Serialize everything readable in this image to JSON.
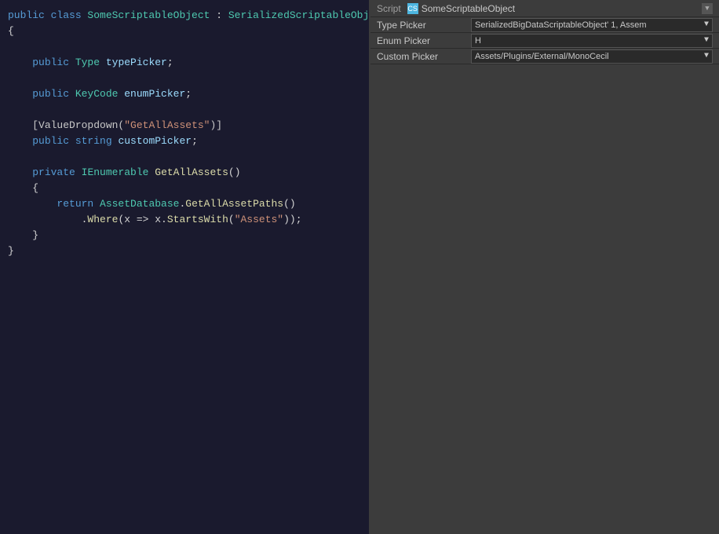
{
  "editor": {
    "background": "#1a1a2e",
    "lines": [
      {
        "id": 1,
        "tokens": [
          {
            "text": "public ",
            "class": "kw"
          },
          {
            "text": "class ",
            "class": "kw"
          },
          {
            "text": "SomeScriptableObject",
            "class": "class-name"
          },
          {
            "text": " : ",
            "class": "plain"
          },
          {
            "text": "SerializedScriptableObject",
            "class": "base-class"
          }
        ]
      },
      {
        "id": 2,
        "tokens": [
          {
            "text": "{",
            "class": "plain"
          }
        ]
      },
      {
        "id": 3,
        "tokens": [
          {
            "text": "    ",
            "class": "plain"
          }
        ]
      },
      {
        "id": 4,
        "tokens": [
          {
            "text": "    ",
            "class": "plain"
          },
          {
            "text": "public ",
            "class": "kw"
          },
          {
            "text": "Type ",
            "class": "kw-type"
          },
          {
            "text": "typePicker",
            "class": "field-name"
          },
          {
            "text": ";",
            "class": "plain"
          }
        ]
      },
      {
        "id": 5,
        "tokens": [
          {
            "text": "    ",
            "class": "plain"
          }
        ]
      },
      {
        "id": 6,
        "tokens": [
          {
            "text": "    ",
            "class": "plain"
          },
          {
            "text": "public ",
            "class": "kw"
          },
          {
            "text": "KeyCode ",
            "class": "kw-type"
          },
          {
            "text": "enumPicker",
            "class": "field-name"
          },
          {
            "text": ";",
            "class": "plain"
          }
        ]
      },
      {
        "id": 7,
        "tokens": [
          {
            "text": "    ",
            "class": "plain"
          }
        ]
      },
      {
        "id": 8,
        "tokens": [
          {
            "text": "    ",
            "class": "plain"
          },
          {
            "text": "[ValueDropdown(",
            "class": "attr"
          },
          {
            "text": "\"GetAllAssets\"",
            "class": "string"
          },
          {
            "text": ")]",
            "class": "attr"
          }
        ]
      },
      {
        "id": 9,
        "tokens": [
          {
            "text": "    ",
            "class": "plain"
          },
          {
            "text": "public ",
            "class": "kw"
          },
          {
            "text": "string ",
            "class": "kw"
          },
          {
            "text": "customPicker",
            "class": "field-name"
          },
          {
            "text": ";",
            "class": "plain"
          }
        ]
      },
      {
        "id": 10,
        "tokens": [
          {
            "text": "    ",
            "class": "plain"
          }
        ]
      },
      {
        "id": 11,
        "tokens": [
          {
            "text": "    ",
            "class": "plain"
          },
          {
            "text": "private ",
            "class": "kw"
          },
          {
            "text": "IEnumerable ",
            "class": "kw-type"
          },
          {
            "text": "GetAllAssets",
            "class": "method"
          },
          {
            "text": "()",
            "class": "plain"
          }
        ]
      },
      {
        "id": 12,
        "tokens": [
          {
            "text": "    ",
            "class": "plain"
          },
          {
            "text": "{",
            "class": "plain"
          }
        ]
      },
      {
        "id": 13,
        "tokens": [
          {
            "text": "        ",
            "class": "plain"
          },
          {
            "text": "return ",
            "class": "kw"
          },
          {
            "text": "AssetDatabase",
            "class": "kw-type"
          },
          {
            "text": ".",
            "class": "plain"
          },
          {
            "text": "GetAllAssetPaths",
            "class": "method"
          },
          {
            "text": "()",
            "class": "plain"
          }
        ]
      },
      {
        "id": 14,
        "tokens": [
          {
            "text": "            ",
            "class": "plain"
          },
          {
            "text": ".",
            "class": "plain"
          },
          {
            "text": "Where",
            "class": "method"
          },
          {
            "text": "(x => x.",
            "class": "plain"
          },
          {
            "text": "StartsWith",
            "class": "method"
          },
          {
            "text": "(",
            "class": "plain"
          },
          {
            "text": "\"Assets\"",
            "class": "string"
          },
          {
            "text": "));",
            "class": "plain"
          }
        ]
      },
      {
        "id": 15,
        "tokens": [
          {
            "text": "    ",
            "class": "plain"
          },
          {
            "text": "}",
            "class": "plain"
          }
        ]
      },
      {
        "id": 16,
        "tokens": [
          {
            "text": "}",
            "class": "plain"
          }
        ]
      }
    ]
  },
  "inspector": {
    "header": {
      "script_label": "Script",
      "script_icon": "CS",
      "script_name": "SomeScriptableObject",
      "expand_icon": "▼"
    },
    "fields": [
      {
        "id": "type_picker",
        "label": "Type Picker",
        "type": "dropdown",
        "value": "SerializedBigDataScriptableObject' 1, Assem",
        "arrow": "▼"
      },
      {
        "id": "enum_picker",
        "label": "Enum Picker",
        "type": "dropdown",
        "value": "H",
        "arrow": "▼"
      },
      {
        "id": "custom_picker",
        "label": "Custom Picker",
        "type": "dropdown",
        "value": "Assets/Plugins/External/MonoCecil",
        "arrow": "▼"
      }
    ]
  }
}
